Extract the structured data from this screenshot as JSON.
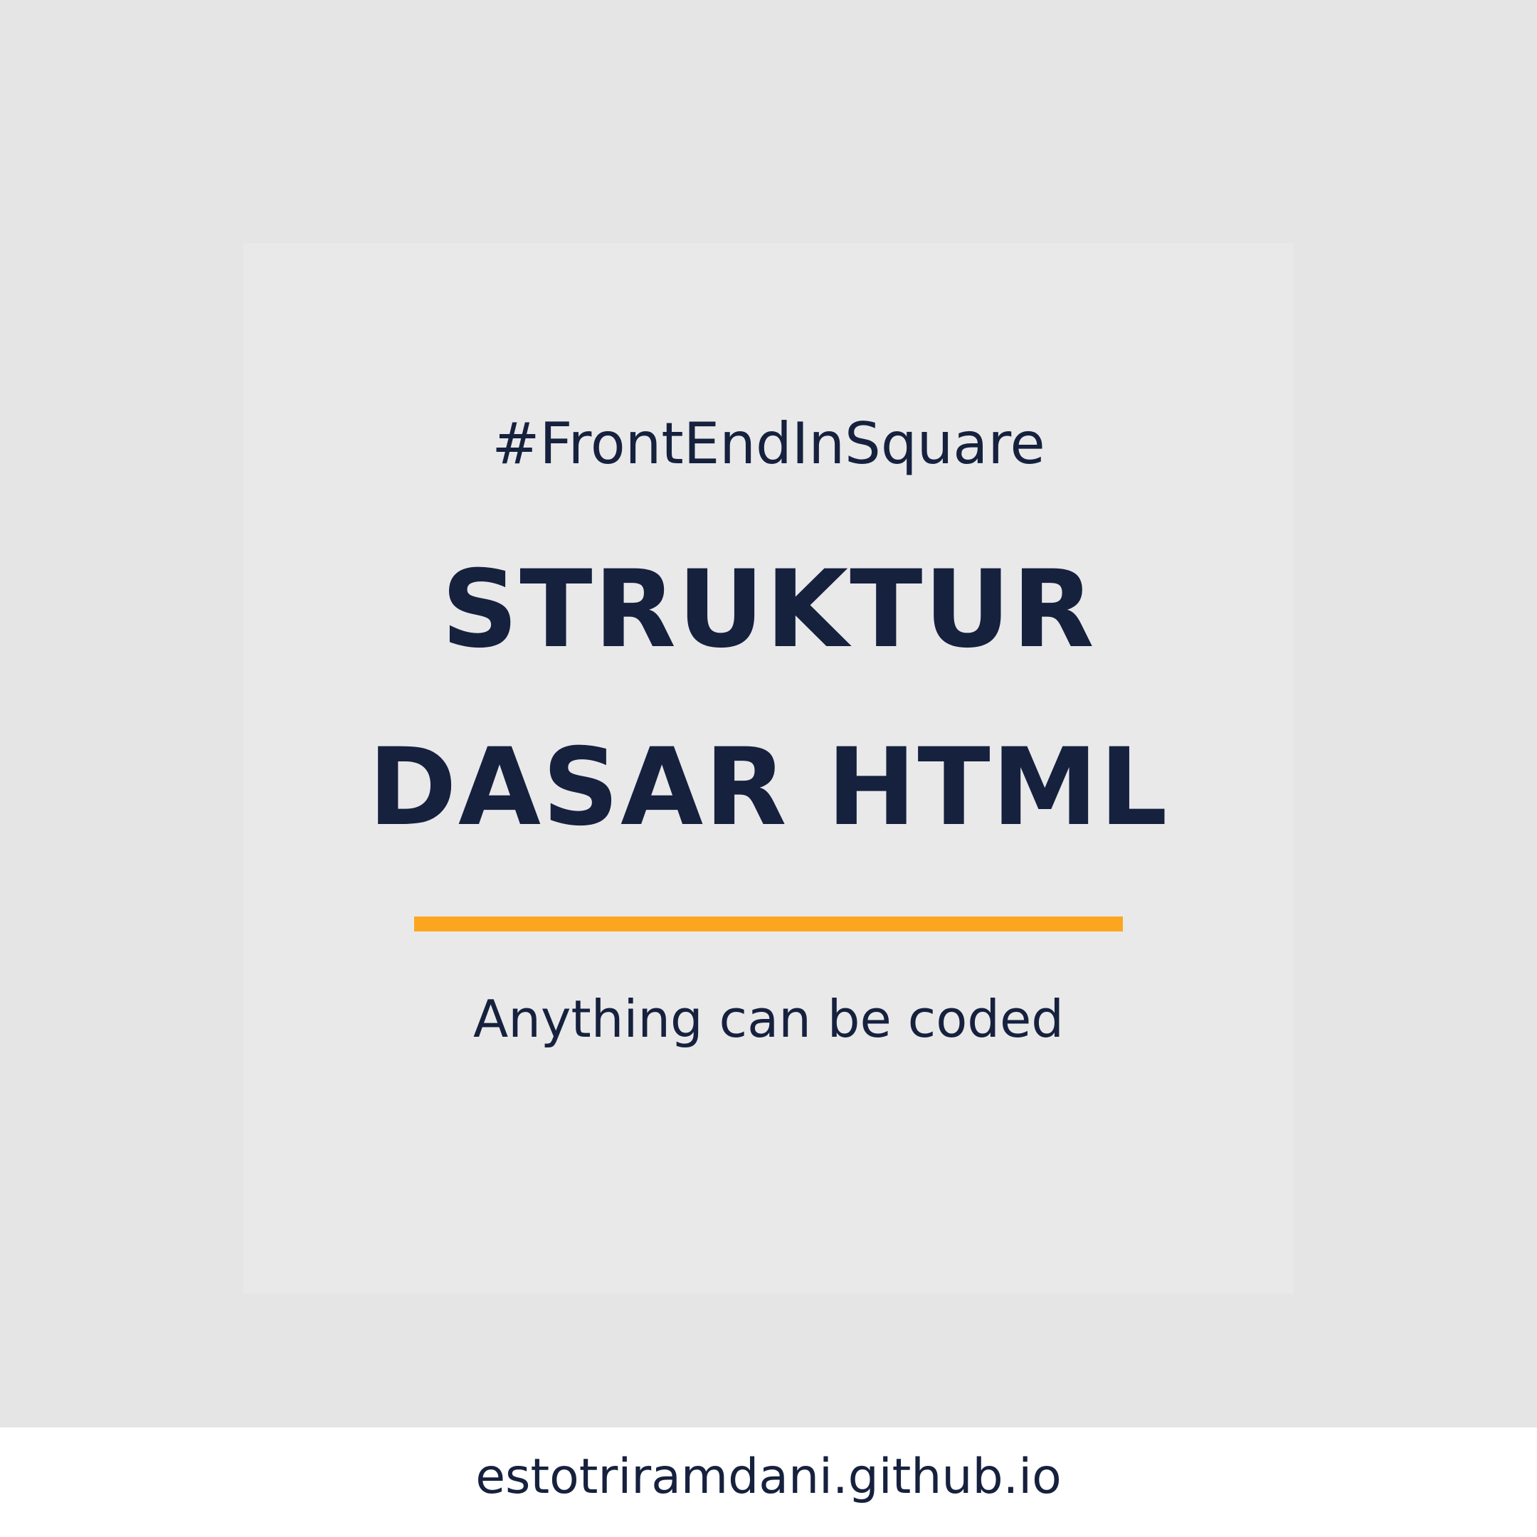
{
  "card": {
    "hashtag": "#FrontEndInSquare",
    "title_line_1": "STRUKTUR",
    "title_line_2": "DASAR HTML",
    "tagline": "Anything can be coded"
  },
  "footer": {
    "url": "estotriramdani.github.io"
  },
  "colors": {
    "background": "#e5e5e5",
    "card": "#e9e9ea",
    "text": "#16213e",
    "accent": "#fca61f",
    "footer": "#ffffff"
  }
}
